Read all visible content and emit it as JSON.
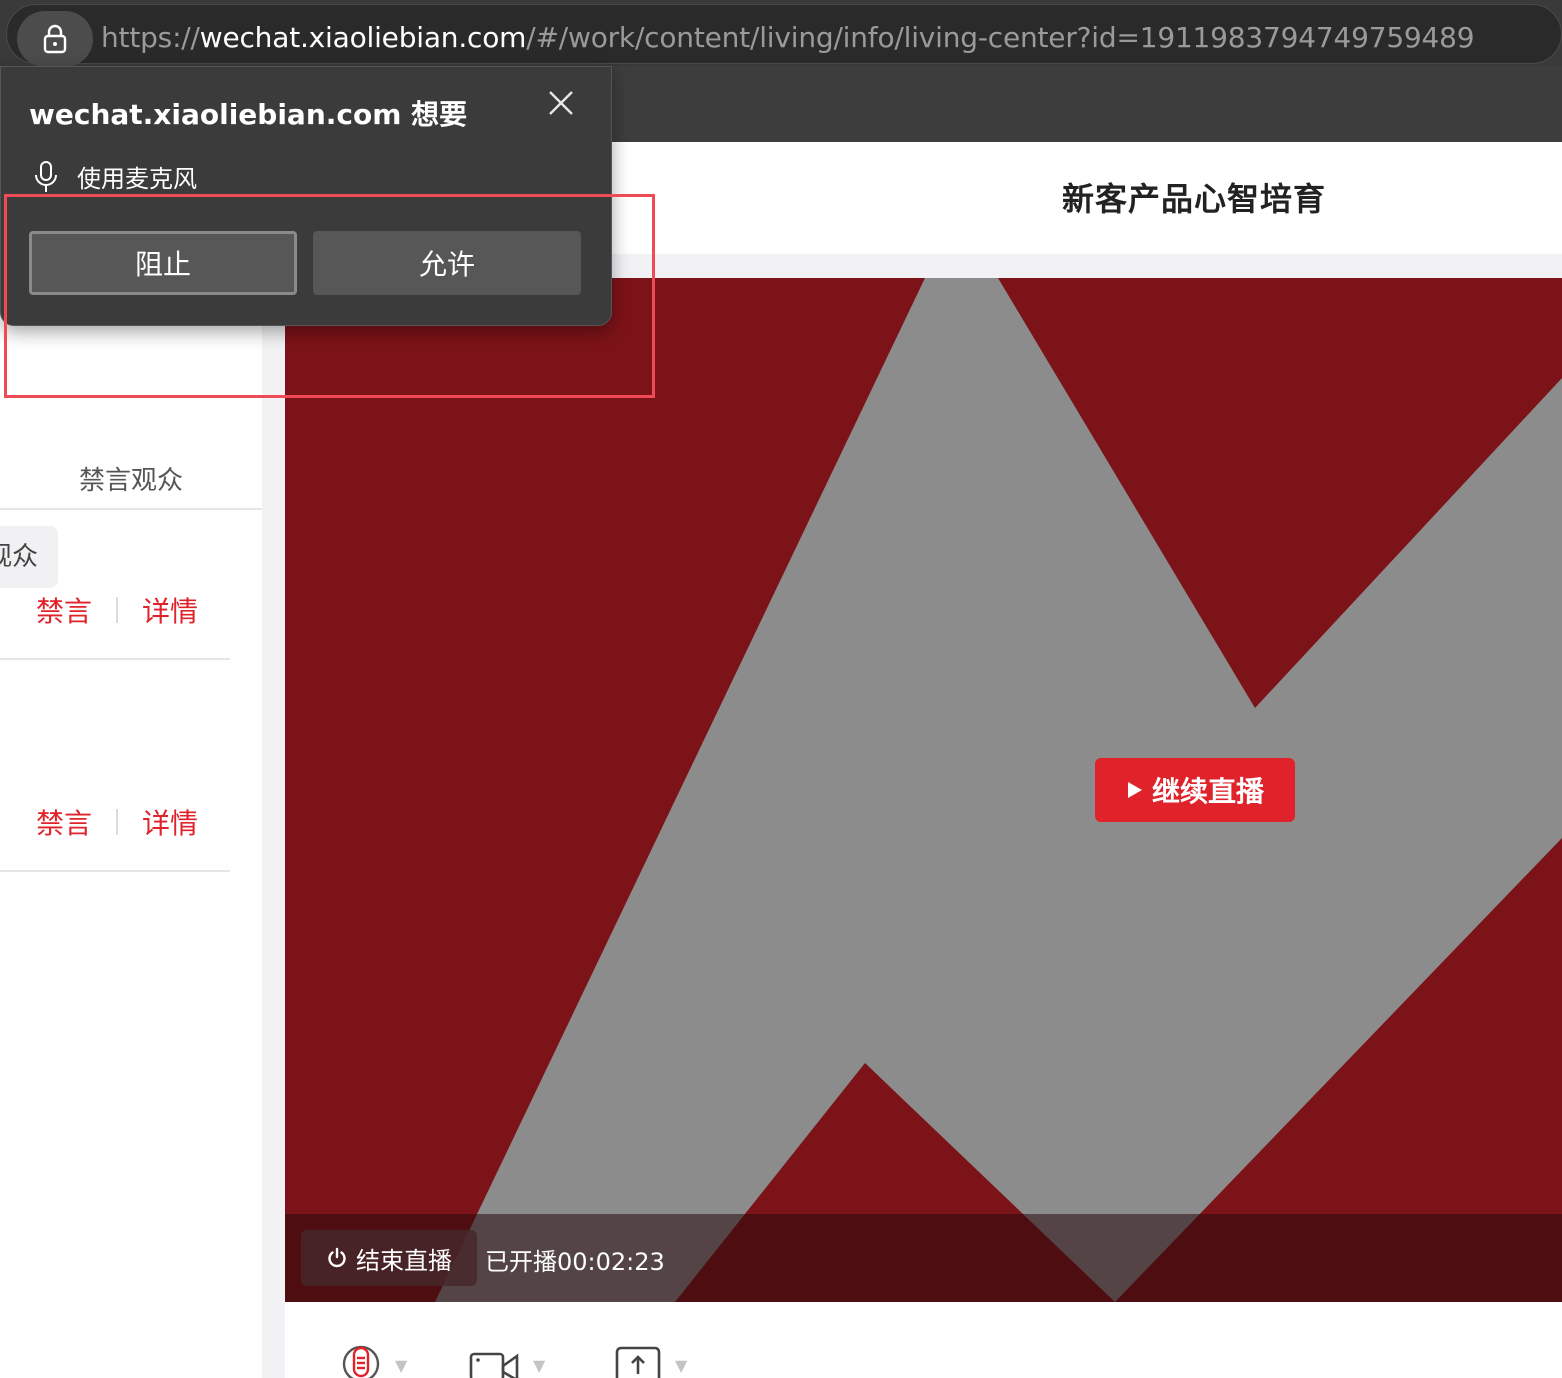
{
  "browser": {
    "url_prefix": "https://",
    "url_host": "wechat.xiaoliebian.com",
    "url_path": "/#/work/content/living/info/living-center?id=1911983794749759489"
  },
  "popup": {
    "title": "wechat.xiaoliebian.com 想要",
    "permission_label": "使用麦克风",
    "block_label": "阻止",
    "allow_label": "允许"
  },
  "sidebar": {
    "tab_mute_label": "禁言观众",
    "chip_label": "观众",
    "rows": [
      {
        "mute_label": "禁言",
        "detail_label": "详情"
      },
      {
        "mute_label": "禁言",
        "detail_label": "详情"
      }
    ]
  },
  "main": {
    "title": "新客产品心智培育",
    "resume_label": "继续直播",
    "end_label": "结束直播",
    "elapsed": "已开播00:02:23"
  },
  "colors": {
    "accent": "#e0222a",
    "video_red": "#7c1318",
    "video_gray": "#8c8c8c",
    "highlight": "#ef4a55"
  },
  "icons": [
    "lock-icon",
    "close-icon",
    "microphone-icon",
    "play-icon",
    "power-icon",
    "camera-icon",
    "share-screen-icon"
  ]
}
